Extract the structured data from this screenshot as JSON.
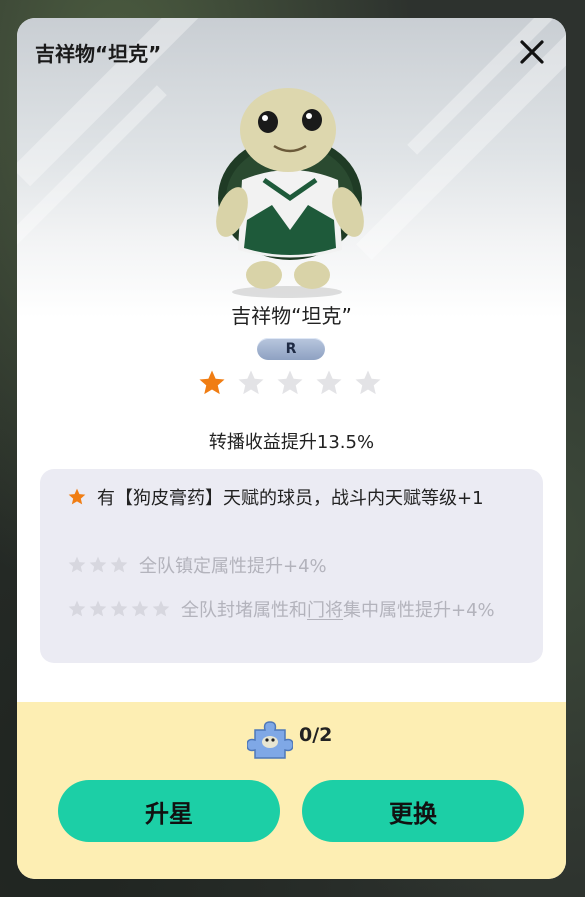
{
  "dialog": {
    "title": "吉祥物“坦克”",
    "mascot_name": "吉祥物“坦克”",
    "rarity_badge": "R",
    "star_level": 1,
    "star_max": 5,
    "bonus_text": "转播收益提升13.5%"
  },
  "perks": [
    {
      "stars": 1,
      "text": "有【狗皮膏药】天赋的球员，战斗内天赋等级+1",
      "active": true
    },
    {
      "stars": 3,
      "text": "全队镇定属性提升+4%",
      "active": false
    },
    {
      "stars": 5,
      "text_a": "全队封堵属性和",
      "text_link": "门将",
      "text_b": "集中属性提升+4%",
      "active": false
    }
  ],
  "fragment": {
    "count_text": "0/2",
    "icon": "puzzle-piece-icon"
  },
  "buttons": {
    "upgrade_label": "升星",
    "replace_label": "更换"
  },
  "colors": {
    "accent": "#1ccfa6",
    "star_active": "#f07d13",
    "star_inactive": "#e3e3e6",
    "bottom_bg": "#fdeeb3"
  }
}
